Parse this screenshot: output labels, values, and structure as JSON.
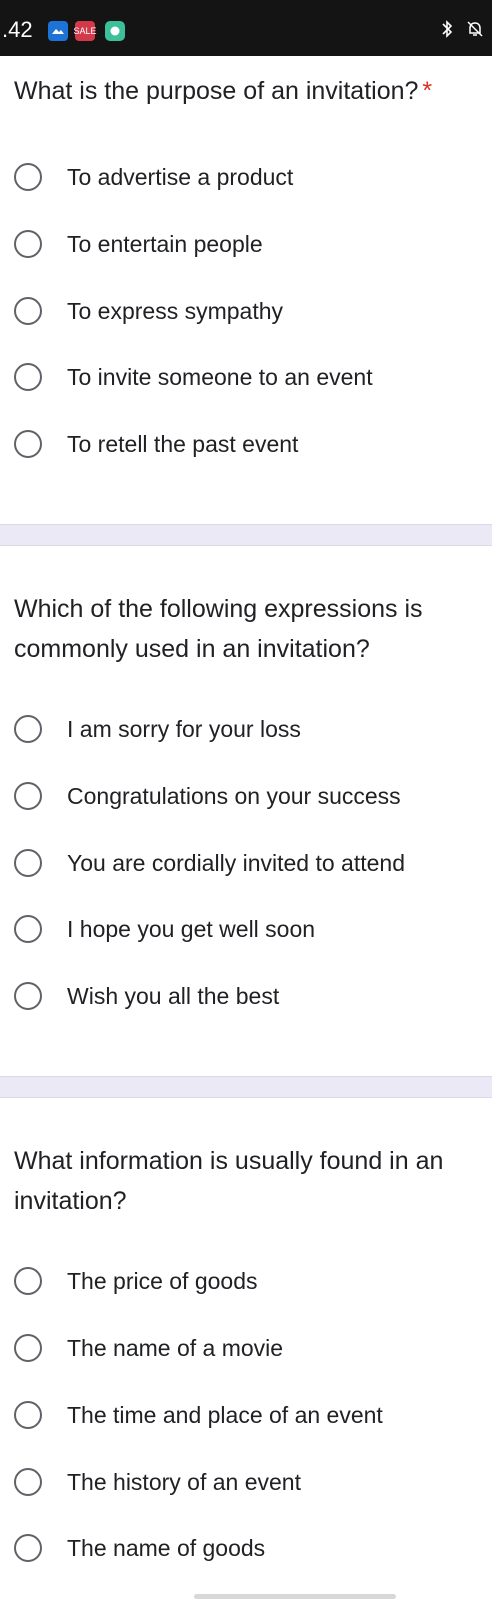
{
  "status_bar": {
    "time": ".42",
    "icons": [
      "weather-app-icon",
      "sale-app-icon",
      "chat-app-icon",
      "bluetooth-icon",
      "bell-muted-icon"
    ],
    "sale_icon_text": "SALE"
  },
  "questions": [
    {
      "text": "What is the purpose of an invitation?",
      "required": "*",
      "options": [
        "To advertise a product",
        "To entertain people",
        "To express sympathy",
        "To invite someone to an event",
        "To retell the past event"
      ]
    },
    {
      "text": "Which of the following expressions is commonly used in an invitation?",
      "options": [
        "I am sorry for your loss",
        "Congratulations on your success",
        "You are cordially invited to attend",
        "I hope you get well soon",
        "Wish you all the best"
      ]
    },
    {
      "text": "What information is usually found in an invitation?",
      "options": [
        "The price of goods",
        "The name of a movie",
        "The time and place of an event",
        "The history of an event",
        "The name of goods"
      ]
    }
  ]
}
